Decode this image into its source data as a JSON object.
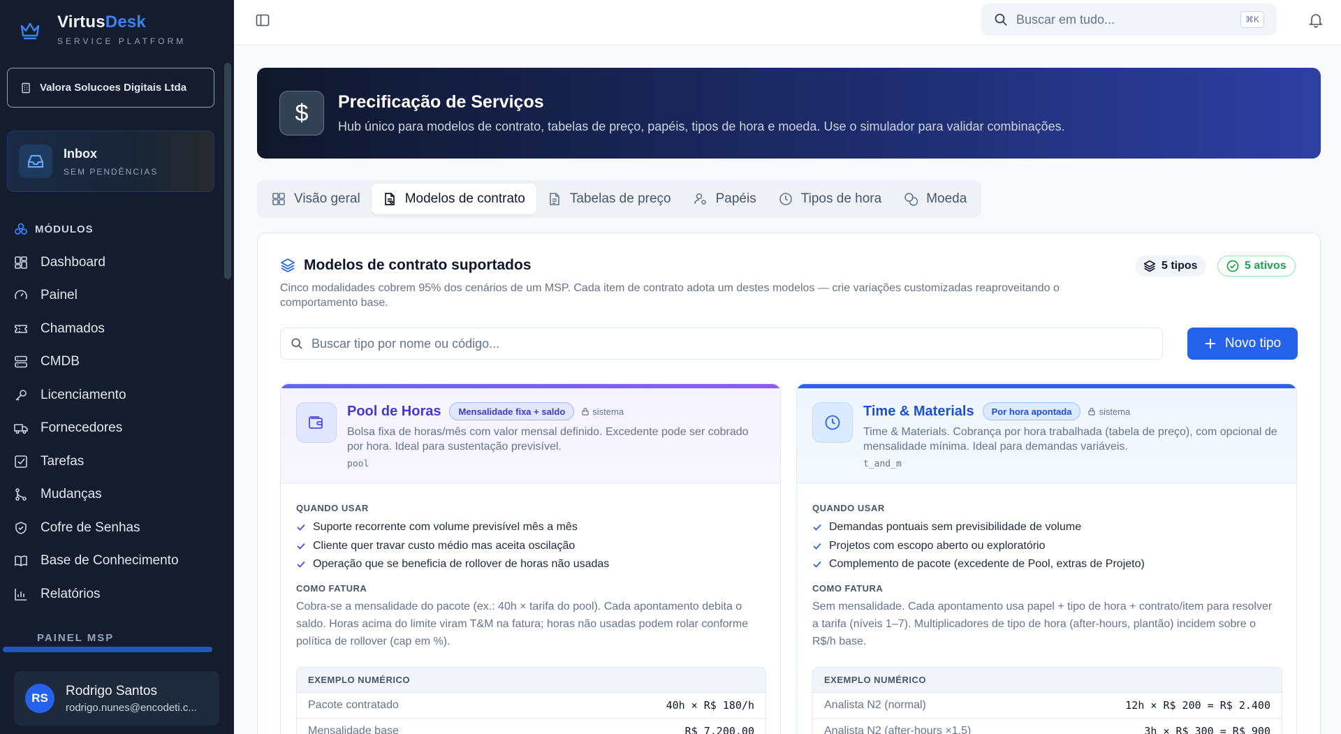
{
  "brand": {
    "name_a": "Virtus",
    "name_b": "Desk",
    "subtitle": "SERVICE PLATFORM"
  },
  "org": {
    "name": "Valora Solucoes Digitais Ltda"
  },
  "inbox": {
    "title": "Inbox",
    "subtitle": "SEM PENDÊNCIAS"
  },
  "sidebar": {
    "modules_heading": "MÓDULOS",
    "items": [
      {
        "label": "Dashboard",
        "icon": "dashboard-icon"
      },
      {
        "label": "Painel",
        "icon": "gauge-icon"
      },
      {
        "label": "Chamados",
        "icon": "ticket-icon"
      },
      {
        "label": "CMDB",
        "icon": "database-icon"
      },
      {
        "label": "Licenciamento",
        "icon": "key-icon"
      },
      {
        "label": "Fornecedores",
        "icon": "truck-icon"
      },
      {
        "label": "Tarefas",
        "icon": "checkbox-icon"
      },
      {
        "label": "Mudanças",
        "icon": "git-branch-icon"
      },
      {
        "label": "Cofre de Senhas",
        "icon": "shield-icon"
      },
      {
        "label": "Base de Conhecimento",
        "icon": "book-icon"
      },
      {
        "label": "Relatórios",
        "icon": "chart-icon"
      }
    ],
    "msp_heading": "PAINEL MSP"
  },
  "user": {
    "initials": "RS",
    "name": "Rodrigo Santos",
    "email": "rodrigo.nunes@encodeti.c..."
  },
  "topbar": {
    "search_placeholder": "Buscar em tudo...",
    "shortcut": "⌘K"
  },
  "hero": {
    "icon": "$",
    "title": "Precificação de Serviços",
    "subtitle": "Hub único para modelos de contrato, tabelas de preço, papéis, tipos de hora e moeda. Use o simulador para validar combinações."
  },
  "tabs": [
    {
      "label": "Visão geral",
      "icon": "grid-icon",
      "active": false
    },
    {
      "label": "Modelos de contrato",
      "icon": "file-contract-icon",
      "active": true
    },
    {
      "label": "Tabelas de preço",
      "icon": "file-table-icon",
      "active": false
    },
    {
      "label": "Papéis",
      "icon": "user-cog-icon",
      "active": false
    },
    {
      "label": "Tipos de hora",
      "icon": "clock-icon",
      "active": false
    },
    {
      "label": "Moeda",
      "icon": "coins-icon",
      "active": false
    }
  ],
  "panel": {
    "title": "Modelos de contrato suportados",
    "description": "Cinco modalidades cobrem 95% dos cenários de um MSP. Cada item de contrato adota um destes modelos — crie variações customizadas reaproveitando o comportamento base.",
    "types_count": "5 tipos",
    "active_count": "5 ativos",
    "search_placeholder": "Buscar tipo por nome ou código...",
    "new_button": "Novo tipo"
  },
  "cards": [
    {
      "name": "Pool de Horas",
      "badge": "Mensalidade fixa + saldo",
      "system": "sistema",
      "description": "Bolsa fixa de horas/mês com valor mensal definido. Excedente pode ser cobrado por hora. Ideal para sustentação previsível.",
      "code": "pool",
      "when_label": "QUANDO USAR",
      "when": [
        "Suporte recorrente com volume previsível mês a mês",
        "Cliente quer travar custo médio mas aceita oscilação",
        "Operação que se beneficia de rollover de horas não usadas"
      ],
      "billing_label": "COMO FATURA",
      "billing": "Cobra-se a mensalidade do pacote (ex.: 40h × tarifa do pool). Cada apontamento debita o saldo. Horas acima do limite viram T&M na fatura; horas não usadas podem rolar conforme política de rollover (cap em %).",
      "example_label": "EXEMPLO NUMÉRICO",
      "example_rows": [
        {
          "label": "Pacote contratado",
          "value": "40h × R$ 180/h"
        },
        {
          "label": "Mensalidade base",
          "value": "R$ 7.200,00"
        }
      ],
      "accent": "#6366f1"
    },
    {
      "name": "Time & Materials",
      "badge": "Por hora apontada",
      "system": "sistema",
      "description": "Time & Materials. Cobrança por hora trabalhada (tabela de preço), com opcional de mensalidade mínima. Ideal para demandas variáveis.",
      "code": "t_and_m",
      "when_label": "QUANDO USAR",
      "when": [
        "Demandas pontuais sem previsibilidade de volume",
        "Projetos com escopo aberto ou exploratório",
        "Complemento de pacote (excedente de Pool, extras de Projeto)"
      ],
      "billing_label": "COMO FATURA",
      "billing": "Sem mensalidade. Cada apontamento usa papel + tipo de hora + contrato/item para resolver a tarifa (níveis 1–7). Multiplicadores de tipo de hora (after-hours, plantão) incidem sobre o R$/h base.",
      "example_label": "EXEMPLO NUMÉRICO",
      "example_rows": [
        {
          "label": "Analista N2 (normal)",
          "value": "12h × R$ 200 = R$ 2.400"
        },
        {
          "label": "Analista N2 (after-hours ×1,5)",
          "value": "3h × R$ 300 = R$ 900"
        }
      ],
      "accent": "#2563eb"
    }
  ]
}
